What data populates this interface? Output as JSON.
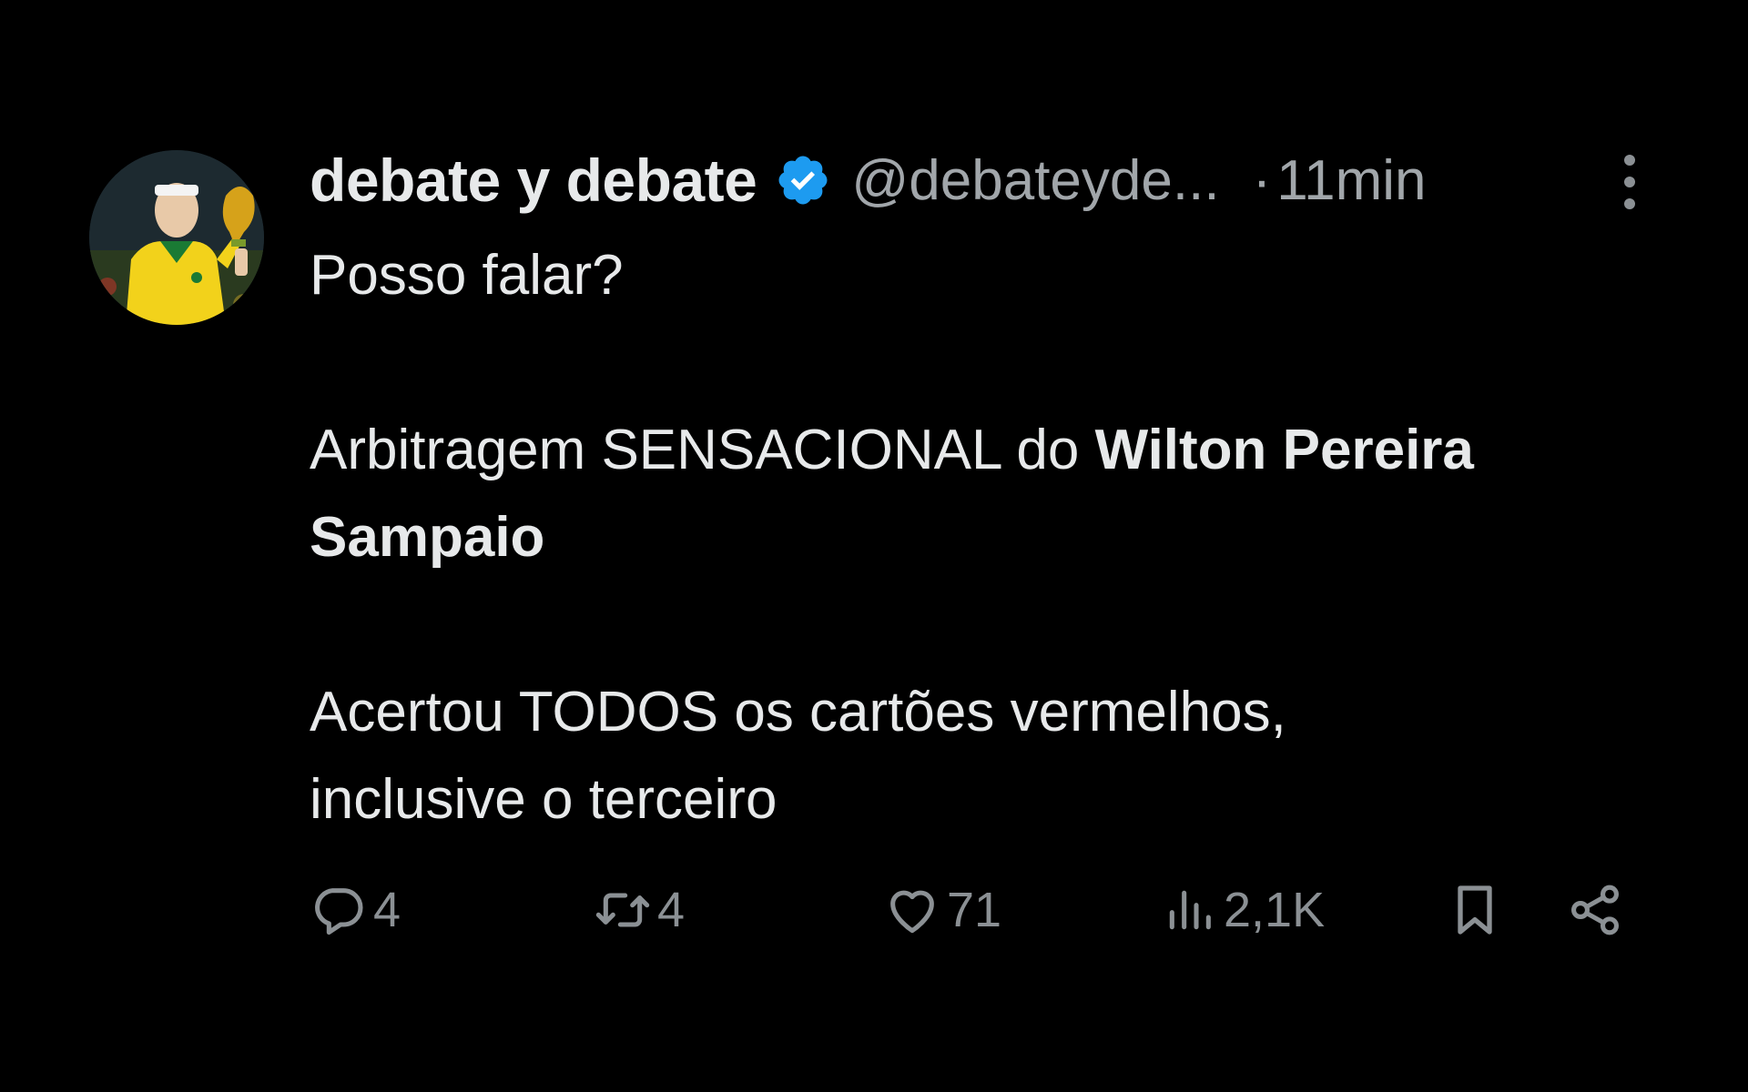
{
  "author": {
    "display_name": "debate y debate",
    "handle": "@debateyde...",
    "separator": "·",
    "time": "11min",
    "verified": true,
    "verified_color": "#1d9bf0",
    "avatar_icon": "avatar-image"
  },
  "tweet": {
    "line1": "Posso falar?",
    "line2_prefix": "Arbitragem SENSACIONAL do ",
    "line2_bold_a": "Wilton Pereira",
    "line2_bold_b": "Sampaio",
    "line3": "Acertou TODOS os cartões vermelhos,",
    "line4": "inclusive o terceiro"
  },
  "actions": {
    "reply_count": "4",
    "retweet_count": "4",
    "like_count": "71",
    "views_count": "2,1K"
  },
  "icons": {
    "reply": "reply-icon",
    "retweet": "retweet-icon",
    "like": "heart-icon",
    "views": "views-icon",
    "bookmark": "bookmark-icon",
    "share": "share-icon",
    "more": "more-vertical-icon"
  },
  "colors": {
    "background": "#000000",
    "primary_text": "#e7e9ea",
    "secondary_text": "#8b9094"
  }
}
